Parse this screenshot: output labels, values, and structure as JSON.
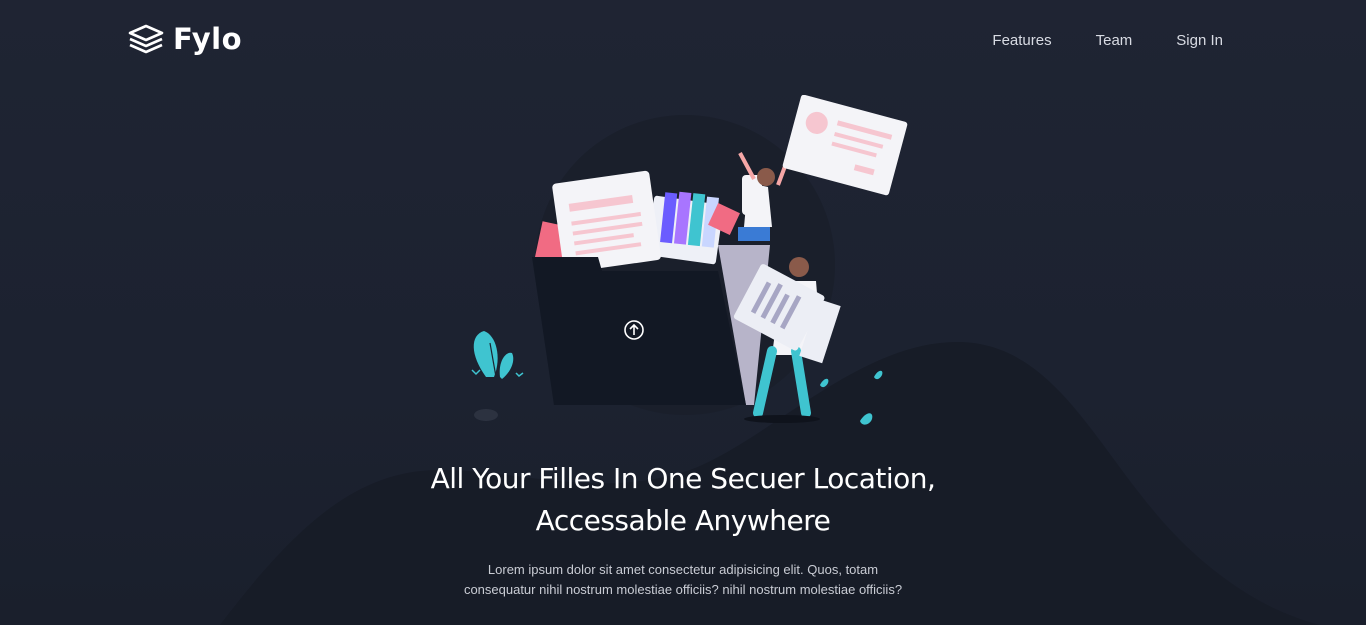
{
  "brand": {
    "name": "Fylo",
    "logo_icon": "stacked-layers-icon"
  },
  "nav": {
    "items": [
      {
        "label": "Features"
      },
      {
        "label": "Team"
      },
      {
        "label": "Sign In"
      }
    ]
  },
  "hero": {
    "title_line1": "All Your Filles In One Secuer Location,",
    "title_line2": "Accessable Anywhere",
    "description": "Lorem ipsum dolor sit amet consectetur adipisicing elit. Quos, totam consequatur nihil nostrum molestiae officiis? nihil nostrum molestiae officiis?",
    "illustration": "people-with-files-folder-illustration",
    "upload_icon": "upload-arrow-icon"
  },
  "colors": {
    "background": "#1c2230",
    "hill": "#161b26",
    "accent_teal": "#3fc4d0",
    "accent_pink": "#f16b83"
  }
}
